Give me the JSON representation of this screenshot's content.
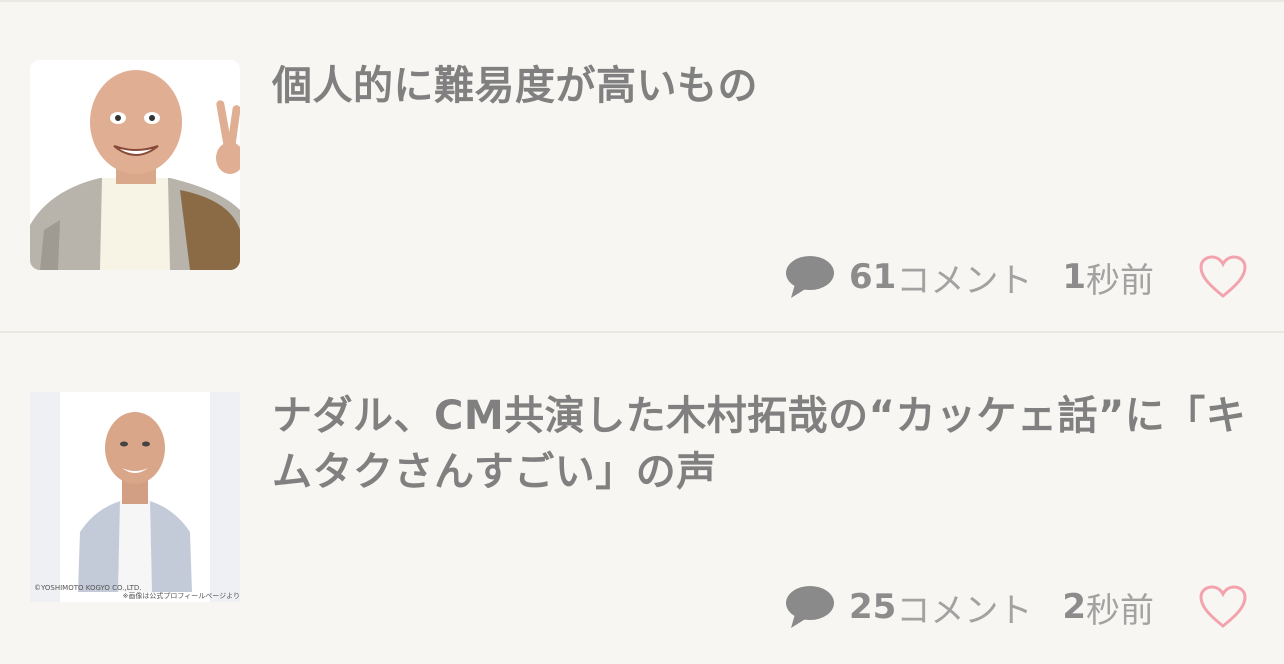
{
  "colors": {
    "background": "#f8f6f2",
    "divider": "#ebe7e2",
    "text": "#808080",
    "heart": "#f2a3ad",
    "comment_icon": "#8a8a8a"
  },
  "articles": [
    {
      "title": "個人的に難易度が高いもの",
      "thumbnail": "person-peace-sign-photo",
      "comment_count": "61",
      "comment_suffix": "コメント",
      "time_num": "1",
      "time_suffix": "秒前",
      "like_icon": "heart-outline-icon"
    },
    {
      "title": "ナダル、CM共演した木村拓哉の“カッケェ話”に「キムタクさんすごい」の声",
      "thumbnail": "person-portrait-photo",
      "credit_line1": "©YOSHIMOTO KOGYO CO.,LTD.",
      "credit_line2": "※画像は公式プロフィールページより",
      "comment_count": "25",
      "comment_suffix": "コメント",
      "time_num": "2",
      "time_suffix": "秒前",
      "like_icon": "heart-outline-icon"
    }
  ]
}
